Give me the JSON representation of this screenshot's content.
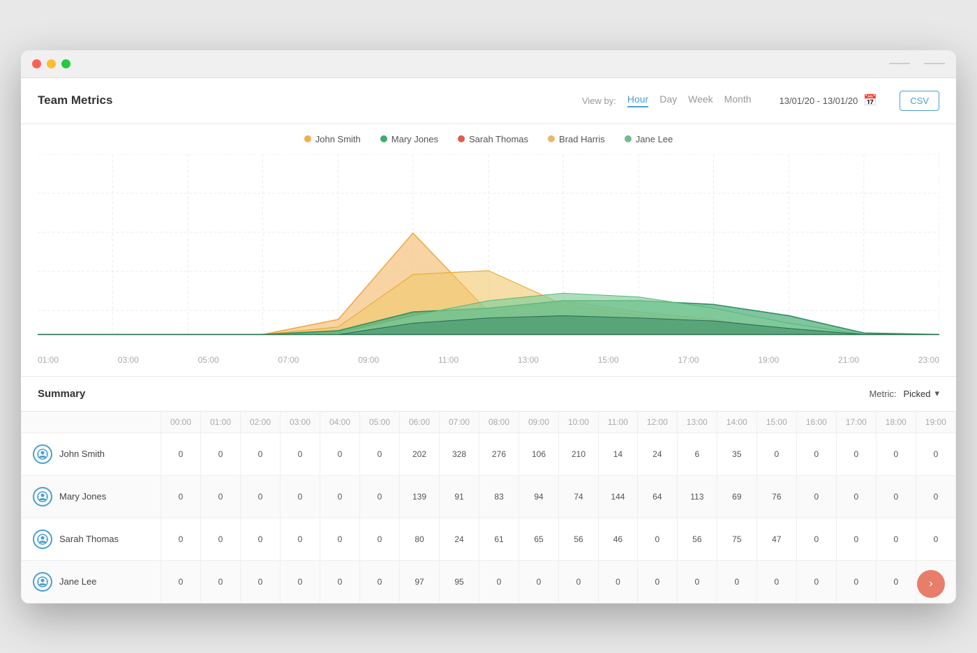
{
  "window": {
    "title": "Team Metrics"
  },
  "header": {
    "title": "Team Metrics",
    "viewBy": "View by:",
    "tabs": [
      "Hour",
      "Day",
      "Week",
      "Month"
    ],
    "activeTab": "Hour",
    "dateRange": "13/01/20 - 13/01/20",
    "csvLabel": "CSV"
  },
  "legend": [
    {
      "name": "John Smith",
      "color": "#f0b04a"
    },
    {
      "name": "Mary Jones",
      "color": "#3cad6b"
    },
    {
      "name": "Sarah Thomas",
      "color": "#e05a4e"
    },
    {
      "name": "Brad Harris",
      "color": "#e8b86d"
    },
    {
      "name": "Jane Lee",
      "color": "#6cbf8a"
    }
  ],
  "chart": {
    "xLabels": [
      "01:00",
      "03:00",
      "05:00",
      "07:00",
      "09:00",
      "11:00",
      "13:00",
      "15:00",
      "17:00",
      "19:00",
      "21:00",
      "23:00"
    ]
  },
  "summary": {
    "title": "Summary",
    "metricLabel": "Metric:",
    "metricValue": "Picked"
  },
  "table": {
    "headers": [
      "",
      "00:00",
      "01:00",
      "02:00",
      "03:00",
      "04:00",
      "05:00",
      "06:00",
      "07:00",
      "08:00",
      "09:00",
      "10:00",
      "11:00",
      "12:00",
      "13:00",
      "14:00",
      "15:00",
      "16:00",
      "17:00",
      "18:00",
      "19:00"
    ],
    "rows": [
      {
        "name": "John Smith",
        "values": [
          0,
          0,
          0,
          0,
          0,
          0,
          202,
          328,
          276,
          106,
          210,
          14,
          24,
          6,
          35,
          0,
          0,
          0,
          0,
          0
        ]
      },
      {
        "name": "Mary Jones",
        "values": [
          0,
          0,
          0,
          0,
          0,
          0,
          139,
          91,
          83,
          94,
          74,
          144,
          64,
          113,
          69,
          76,
          0,
          0,
          0,
          0
        ]
      },
      {
        "name": "Sarah Thomas",
        "values": [
          0,
          0,
          0,
          0,
          0,
          0,
          80,
          24,
          61,
          65,
          56,
          46,
          0,
          56,
          75,
          47,
          0,
          0,
          0,
          0
        ]
      },
      {
        "name": "Jane Lee",
        "values": [
          0,
          0,
          0,
          0,
          0,
          0,
          97,
          95,
          0,
          0,
          0,
          0,
          0,
          0,
          0,
          0,
          0,
          0,
          0,
          0
        ]
      }
    ]
  }
}
